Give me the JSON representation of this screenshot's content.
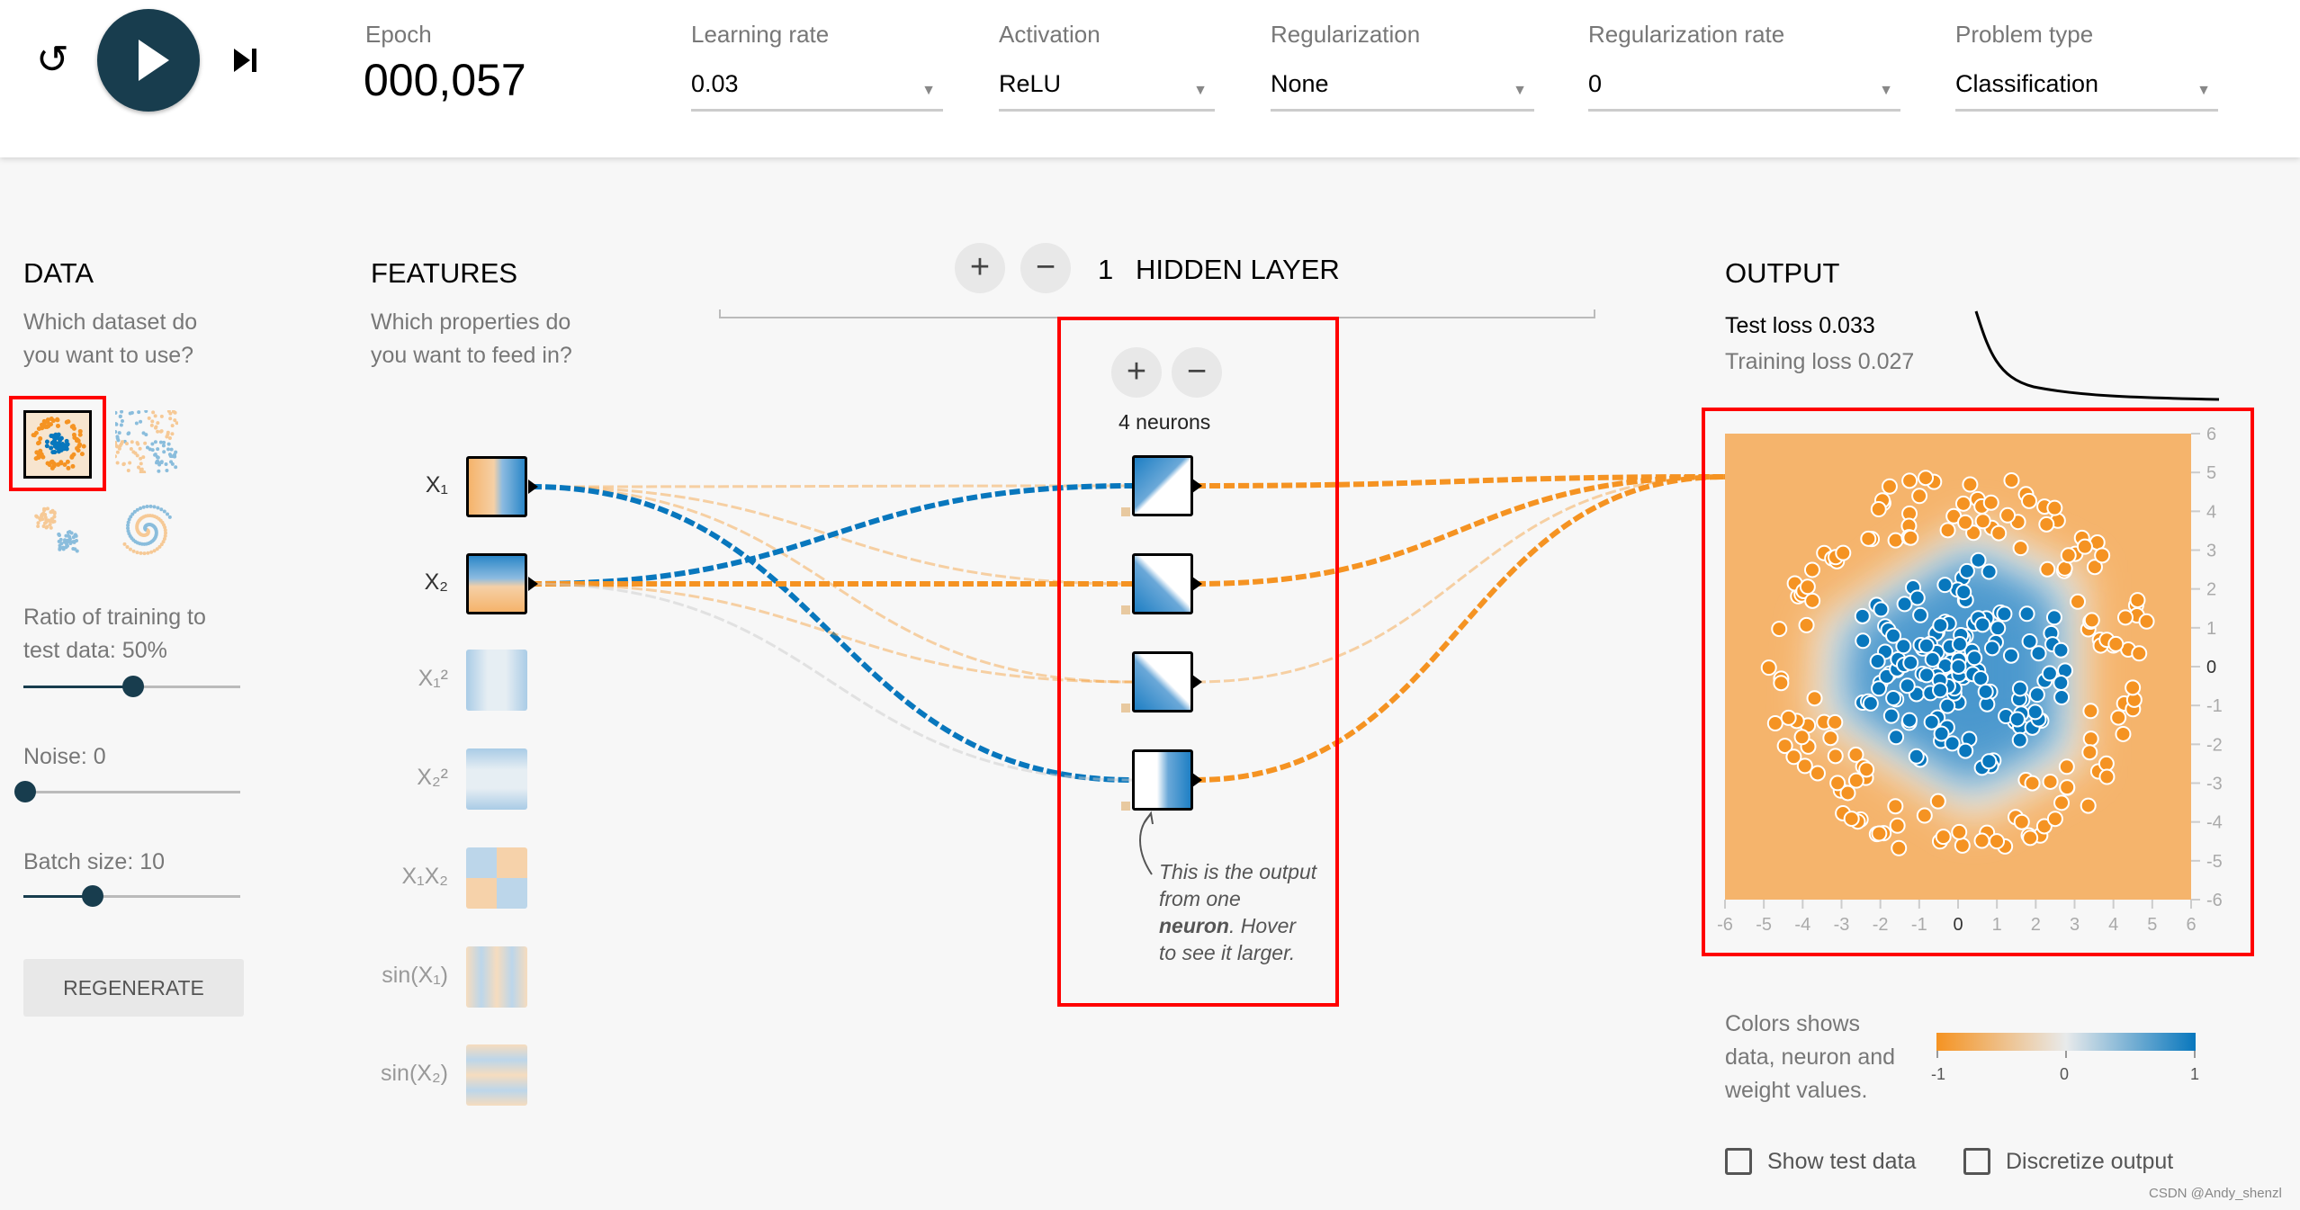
{
  "header": {
    "reset_icon": "reset-icon",
    "play_icon": "play-icon",
    "step_icon": "step-forward-icon",
    "epoch_label": "Epoch",
    "epoch_value": "000,057",
    "controls": [
      {
        "label": "Learning rate",
        "value": "0.03"
      },
      {
        "label": "Activation",
        "value": "ReLU"
      },
      {
        "label": "Regularization",
        "value": "None"
      },
      {
        "label": "Regularization rate",
        "value": "0"
      },
      {
        "label": "Problem type",
        "value": "Classification"
      }
    ]
  },
  "data": {
    "title": "DATA",
    "desc1": "Which dataset do",
    "desc2": "you want to use?",
    "datasets": [
      "circle",
      "xor",
      "gaussian",
      "spiral"
    ],
    "selected": "circle",
    "ratio_label1": "Ratio of training to",
    "ratio_label2": "test data:  50%",
    "ratio": 50,
    "noise_label": "Noise:  0",
    "noise": 0,
    "batch_label": "Batch size:  10",
    "batch": 10,
    "regenerate": "REGENERATE"
  },
  "features": {
    "title": "FEATURES",
    "desc1": "Which properties do",
    "desc2": "you want to feed in?",
    "items": [
      {
        "label": "X₁",
        "active": true
      },
      {
        "label": "X₂",
        "active": true
      },
      {
        "label": "X₁²",
        "active": false
      },
      {
        "label": "X₂²",
        "active": false
      },
      {
        "label": "X₁X₂",
        "active": false
      },
      {
        "label": "sin(X₁)",
        "active": false
      },
      {
        "label": "sin(X₂)",
        "active": false
      }
    ]
  },
  "hidden": {
    "count": "1",
    "title": "HIDDEN LAYER",
    "neurons_label": "4 neurons",
    "annotation1": "This is the output",
    "annotation2": "from one",
    "annotation3": "neuron",
    "annotation4": ". Hover",
    "annotation5": "to see it larger.",
    "input_weights": [
      [
        -0.25,
        -0.3,
        -0.3,
        0.9
      ],
      [
        0.9,
        -0.8,
        -0.3,
        0.05
      ]
    ],
    "output_weights": [
      -0.9,
      -0.8,
      -0.3,
      -0.8
    ]
  },
  "output": {
    "title": "OUTPUT",
    "test_loss": "Test loss 0.033",
    "training_loss": "Training loss 0.027",
    "x_ticks": [
      "-6",
      "-5",
      "-4",
      "-3",
      "-2",
      "-1",
      "0",
      "1",
      "2",
      "3",
      "4",
      "5",
      "6"
    ],
    "y_ticks": [
      "6",
      "5",
      "4",
      "3",
      "2",
      "1",
      "0",
      "-1",
      "-2",
      "-3",
      "-4",
      "-5",
      "-6"
    ],
    "legend1": "Colors shows",
    "legend2": "data, neuron and",
    "legend3": "weight values.",
    "legend_ticks": [
      "-1",
      "0",
      "1"
    ],
    "show_test": "Show test data",
    "discretize": "Discretize output",
    "show_test_checked": false,
    "discretize_checked": false
  },
  "colors": {
    "orange": "#f59322",
    "blue": "#0877bd",
    "play": "#183d4e"
  },
  "watermark": "CSDN @Andy_shenzl"
}
